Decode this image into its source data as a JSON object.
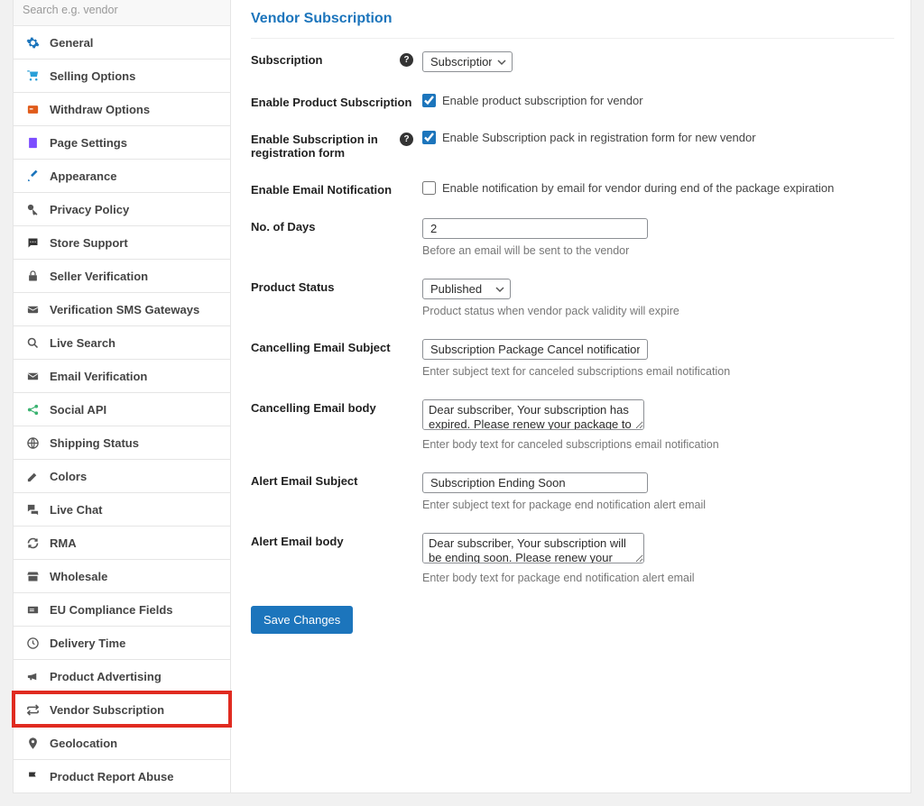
{
  "sidebar": {
    "search_placeholder": "Search e.g. vendor",
    "items": [
      {
        "label": "General",
        "icon": "gear",
        "color": "#1c75bc"
      },
      {
        "label": "Selling Options",
        "icon": "cart",
        "color": "#2a9fd8"
      },
      {
        "label": "Withdraw Options",
        "icon": "withdraw",
        "color": "#e05b1a"
      },
      {
        "label": "Page Settings",
        "icon": "page",
        "color": "#7c4dff"
      },
      {
        "label": "Appearance",
        "icon": "brush",
        "color": "#1c75bc"
      },
      {
        "label": "Privacy Policy",
        "icon": "key",
        "color": "#555"
      },
      {
        "label": "Store Support",
        "icon": "chat",
        "color": "#333"
      },
      {
        "label": "Seller Verification",
        "icon": "lock",
        "color": "#555"
      },
      {
        "label": "Verification SMS Gateways",
        "icon": "sms",
        "color": "#555"
      },
      {
        "label": "Live Search",
        "icon": "search",
        "color": "#555"
      },
      {
        "label": "Email Verification",
        "icon": "mail",
        "color": "#555"
      },
      {
        "label": "Social API",
        "icon": "share",
        "color": "#3cb371"
      },
      {
        "label": "Shipping Status",
        "icon": "globe",
        "color": "#555"
      },
      {
        "label": "Colors",
        "icon": "pencil",
        "color": "#555"
      },
      {
        "label": "Live Chat",
        "icon": "comments",
        "color": "#555"
      },
      {
        "label": "RMA",
        "icon": "refresh",
        "color": "#555"
      },
      {
        "label": "Wholesale",
        "icon": "store",
        "color": "#555"
      },
      {
        "label": "EU Compliance Fields",
        "icon": "eu",
        "color": "#555"
      },
      {
        "label": "Delivery Time",
        "icon": "clock",
        "color": "#555"
      },
      {
        "label": "Product Advertising",
        "icon": "megaphone",
        "color": "#555"
      },
      {
        "label": "Vendor Subscription",
        "icon": "repeat",
        "color": "#555",
        "active": true,
        "highlighted": true
      },
      {
        "label": "Geolocation",
        "icon": "pin",
        "color": "#555"
      },
      {
        "label": "Product Report Abuse",
        "icon": "flag",
        "color": "#333"
      }
    ]
  },
  "page": {
    "title": "Vendor Subscription",
    "save_label": "Save Changes"
  },
  "form": {
    "subscription": {
      "label": "Subscription",
      "value": "Subscriptions"
    },
    "enable_product_sub": {
      "label": "Enable Product Subscription",
      "checked": true,
      "checkbox_label": "Enable product subscription for vendor"
    },
    "enable_reg_sub": {
      "label": "Enable Subscription in registration form",
      "checked": true,
      "checkbox_label": "Enable Subscription pack in registration form for new vendor"
    },
    "enable_email_notif": {
      "label": "Enable Email Notification",
      "checked": false,
      "checkbox_label": "Enable notification by email for vendor during end of the package expiration"
    },
    "no_of_days": {
      "label": "No. of Days",
      "value": "2",
      "desc": "Before an email will be sent to the vendor"
    },
    "product_status": {
      "label": "Product Status",
      "value": "Published",
      "desc": "Product status when vendor pack validity will expire"
    },
    "cancel_subject": {
      "label": "Cancelling Email Subject",
      "value": "Subscription Package Cancel notification",
      "desc": "Enter subject text for canceled subscriptions email notification"
    },
    "cancel_body": {
      "label": "Cancelling Email body",
      "value": "Dear subscriber, Your subscription has expired. Please renew your package to continue using it.",
      "desc": "Enter body text for canceled subscriptions email notification"
    },
    "alert_subject": {
      "label": "Alert Email Subject",
      "value": "Subscription Ending Soon",
      "desc": "Enter subject text for package end notification alert email"
    },
    "alert_body": {
      "label": "Alert Email body",
      "value": "Dear subscriber, Your subscription will be ending soon. Please renew your package in a timely",
      "desc": "Enter body text for package end notification alert email"
    }
  }
}
